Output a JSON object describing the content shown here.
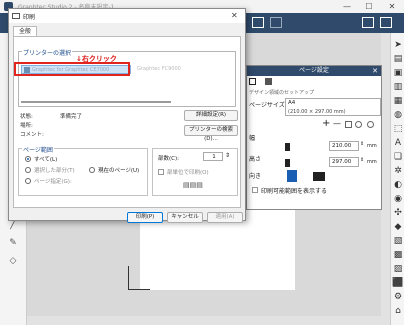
{
  "app": {
    "title": "Graphtec Studio 2 - 名称未設定-1",
    "win_min": "—",
    "win_max": "☐",
    "win_close": "✕"
  },
  "dialog": {
    "title": "印刷",
    "close": "✕",
    "tab": "全般",
    "printer_group_label": "プリンターの選択",
    "printer_name": "Graphtec for Graphtec CE7000",
    "printer_name_2": "Graphtec FC9000",
    "annotation": "↓右クリック",
    "status_label": "状態:",
    "status_value": "準備完了",
    "location_label": "場所:",
    "comment_label": "コメント:",
    "detail_button": "詳細設定(R)",
    "find_printer_button": "プリンターの検索(D)...",
    "page_range_label": "ページ範囲",
    "all_label": "すべて(L)",
    "selection_label": "選択した部分(T)",
    "current_page_label": "現在のページ(U)",
    "pages_label": "ページ指定(G):",
    "copies_label": "部数(C):",
    "copies_value": "1",
    "collate_label": "部単位で印刷(O)",
    "print_button": "印刷(P)",
    "cancel_button": "キャンセル",
    "apply_button": "適用(A)"
  },
  "page_settings": {
    "title": "ページ設定",
    "close": "✕",
    "subtitle": "デザイン領域のセットアップ",
    "size_label": "ページサイズ",
    "size_value": "A4",
    "size_detail": "(210.00 × 297.00 mm)",
    "width_value": "210.00",
    "height_value": "297.00",
    "unit": "mm",
    "width_label": "幅",
    "height_label": "高さ",
    "orientation_label": "向き",
    "show_print_area_label": "印刷可能範囲を表示する",
    "plus": "+",
    "minus": "—"
  },
  "colors": {
    "accent": "#2f4a6b",
    "annotation": "#e0251f",
    "selection": "#cfe3f7"
  }
}
